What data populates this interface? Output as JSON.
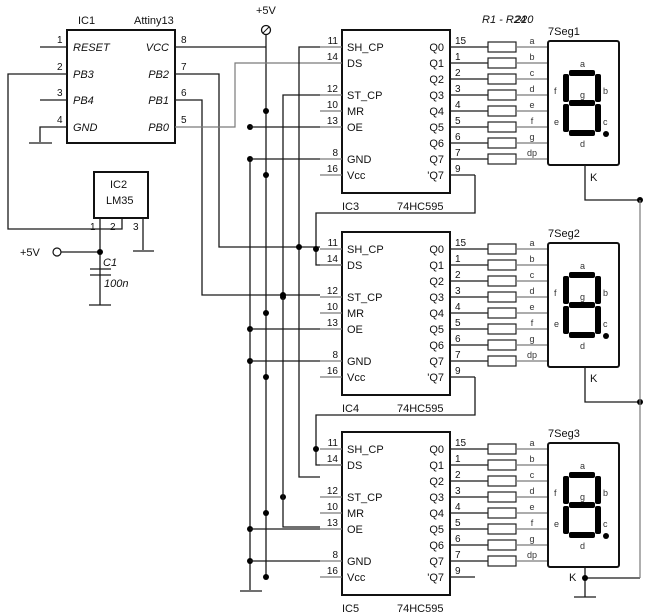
{
  "supply": {
    "label": "+5V"
  },
  "ic1": {
    "ref": "IC1",
    "part": "Attiny13",
    "left_pins": [
      {
        "num": "1",
        "name": "RESET"
      },
      {
        "num": "2",
        "name": "PB3"
      },
      {
        "num": "3",
        "name": "PB4"
      },
      {
        "num": "4",
        "name": "GND"
      }
    ],
    "right_pins": [
      {
        "num": "8",
        "name": "VCC"
      },
      {
        "num": "7",
        "name": "PB2"
      },
      {
        "num": "6",
        "name": "PB1"
      },
      {
        "num": "5",
        "name": "PB0"
      }
    ]
  },
  "ic2": {
    "ref": "IC2",
    "part": "LM35",
    "pins": [
      "1",
      "2",
      "3"
    ]
  },
  "c1": {
    "ref": "C1",
    "value": "100n",
    "supply": "+5V"
  },
  "resistors": {
    "label": "R1 - R24",
    "value": "220"
  },
  "shift_registers": [
    {
      "ref": "IC3",
      "part": "74HC595"
    },
    {
      "ref": "IC4",
      "part": "74HC595"
    },
    {
      "ref": "IC5",
      "part": "74HC595"
    }
  ],
  "sr_left_pins": [
    {
      "num": "11",
      "name": "SH_CP"
    },
    {
      "num": "14",
      "name": "DS"
    },
    {
      "num": "12",
      "name": "ST_CP"
    },
    {
      "num": "10",
      "name": "MR"
    },
    {
      "num": "13",
      "name": "OE"
    },
    {
      "num": "8",
      "name": "GND"
    },
    {
      "num": "16",
      "name": "Vcc"
    }
  ],
  "sr_right_pins": [
    {
      "num": "15",
      "name": "Q0"
    },
    {
      "num": "1",
      "name": "Q1"
    },
    {
      "num": "2",
      "name": "Q2"
    },
    {
      "num": "3",
      "name": "Q3"
    },
    {
      "num": "4",
      "name": "Q4"
    },
    {
      "num": "5",
      "name": "Q5"
    },
    {
      "num": "6",
      "name": "Q6"
    },
    {
      "num": "7",
      "name": "Q7"
    },
    {
      "num": "9",
      "name": "'Q7"
    }
  ],
  "displays": [
    {
      "ref": "7Seg1"
    },
    {
      "ref": "7Seg2"
    },
    {
      "ref": "7Seg3"
    }
  ],
  "segment_lines": [
    "a",
    "b",
    "c",
    "d",
    "e",
    "f",
    "g",
    "dp"
  ],
  "segment_labels": {
    "a": "a",
    "b": "b",
    "c": "c",
    "d": "d",
    "e": "e",
    "f": "f",
    "g": "g"
  },
  "cathode_label": "K"
}
